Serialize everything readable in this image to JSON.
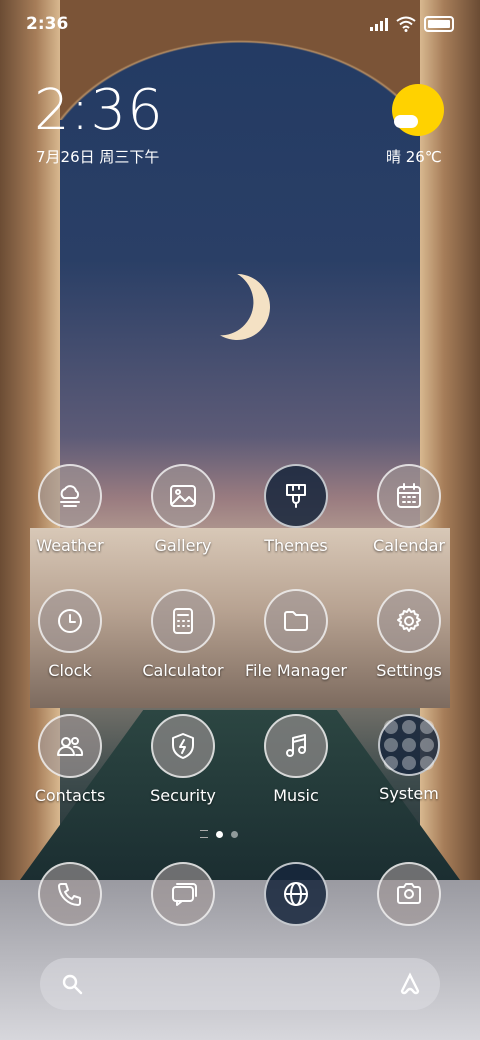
{
  "status_bar": {
    "time": "2:36",
    "icons": [
      "signal-icon",
      "wifi-icon",
      "battery-icon"
    ]
  },
  "clock_widget": {
    "time": "2:36",
    "date": "7月26日 周三下午"
  },
  "weather_widget": {
    "text": "晴 26℃",
    "icon": "sunny-cloud-icon"
  },
  "apps": [
    {
      "label": "Weather",
      "icon": "weather-icon"
    },
    {
      "label": "Gallery",
      "icon": "gallery-icon"
    },
    {
      "label": "Themes",
      "icon": "brush-icon"
    },
    {
      "label": "Calendar",
      "icon": "calendar-icon"
    },
    {
      "label": "Clock",
      "icon": "clock-icon"
    },
    {
      "label": "Calculator",
      "icon": "calculator-icon"
    },
    {
      "label": "File Manager",
      "icon": "folder-icon"
    },
    {
      "label": "Settings",
      "icon": "gear-icon"
    },
    {
      "label": "Contacts",
      "icon": "contacts-icon"
    },
    {
      "label": "Security",
      "icon": "shield-icon"
    },
    {
      "label": "Music",
      "icon": "music-note-icon"
    },
    {
      "label": "System",
      "icon": "folder-grid-icon"
    }
  ],
  "page_indicator": {
    "current": 1,
    "total": 2
  },
  "dock": [
    {
      "icon": "phone-icon"
    },
    {
      "icon": "messages-icon"
    },
    {
      "icon": "browser-icon"
    },
    {
      "icon": "camera-icon"
    }
  ],
  "search": {
    "left_icon": "search-icon",
    "right_icon": "assistant-icon"
  }
}
